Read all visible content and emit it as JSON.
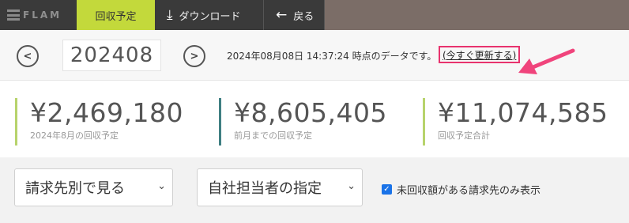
{
  "nav": {
    "logo_text": "FLAM",
    "active_tab": "回収予定",
    "download_label": "ダウンロード",
    "back_label": "戻る"
  },
  "month": {
    "value": "202408",
    "asof_text": "2024年08月08日 14:37:24 時点のデータです。",
    "refresh_label": "(今すぐ更新する)"
  },
  "summary": [
    {
      "amount": "¥2,469,180",
      "label": "2024年8月の回収予定"
    },
    {
      "amount": "¥8,605,405",
      "label": "前月までの回収予定"
    },
    {
      "amount": "¥11,074,585",
      "label": "回収予定合計"
    }
  ],
  "filters": {
    "view_select": "請求先別で見る",
    "staff_select": "自社担当者の指定",
    "unpaid_only_label": "未回収額がある請求先のみ表示",
    "unpaid_only_checked": true
  },
  "colors": {
    "nav_bg": "#3a3a3a",
    "nav_active": "#c3d93b",
    "highlight": "#e8336e",
    "accent_green": "#b7d36c",
    "accent_teal": "#3f7f82"
  }
}
